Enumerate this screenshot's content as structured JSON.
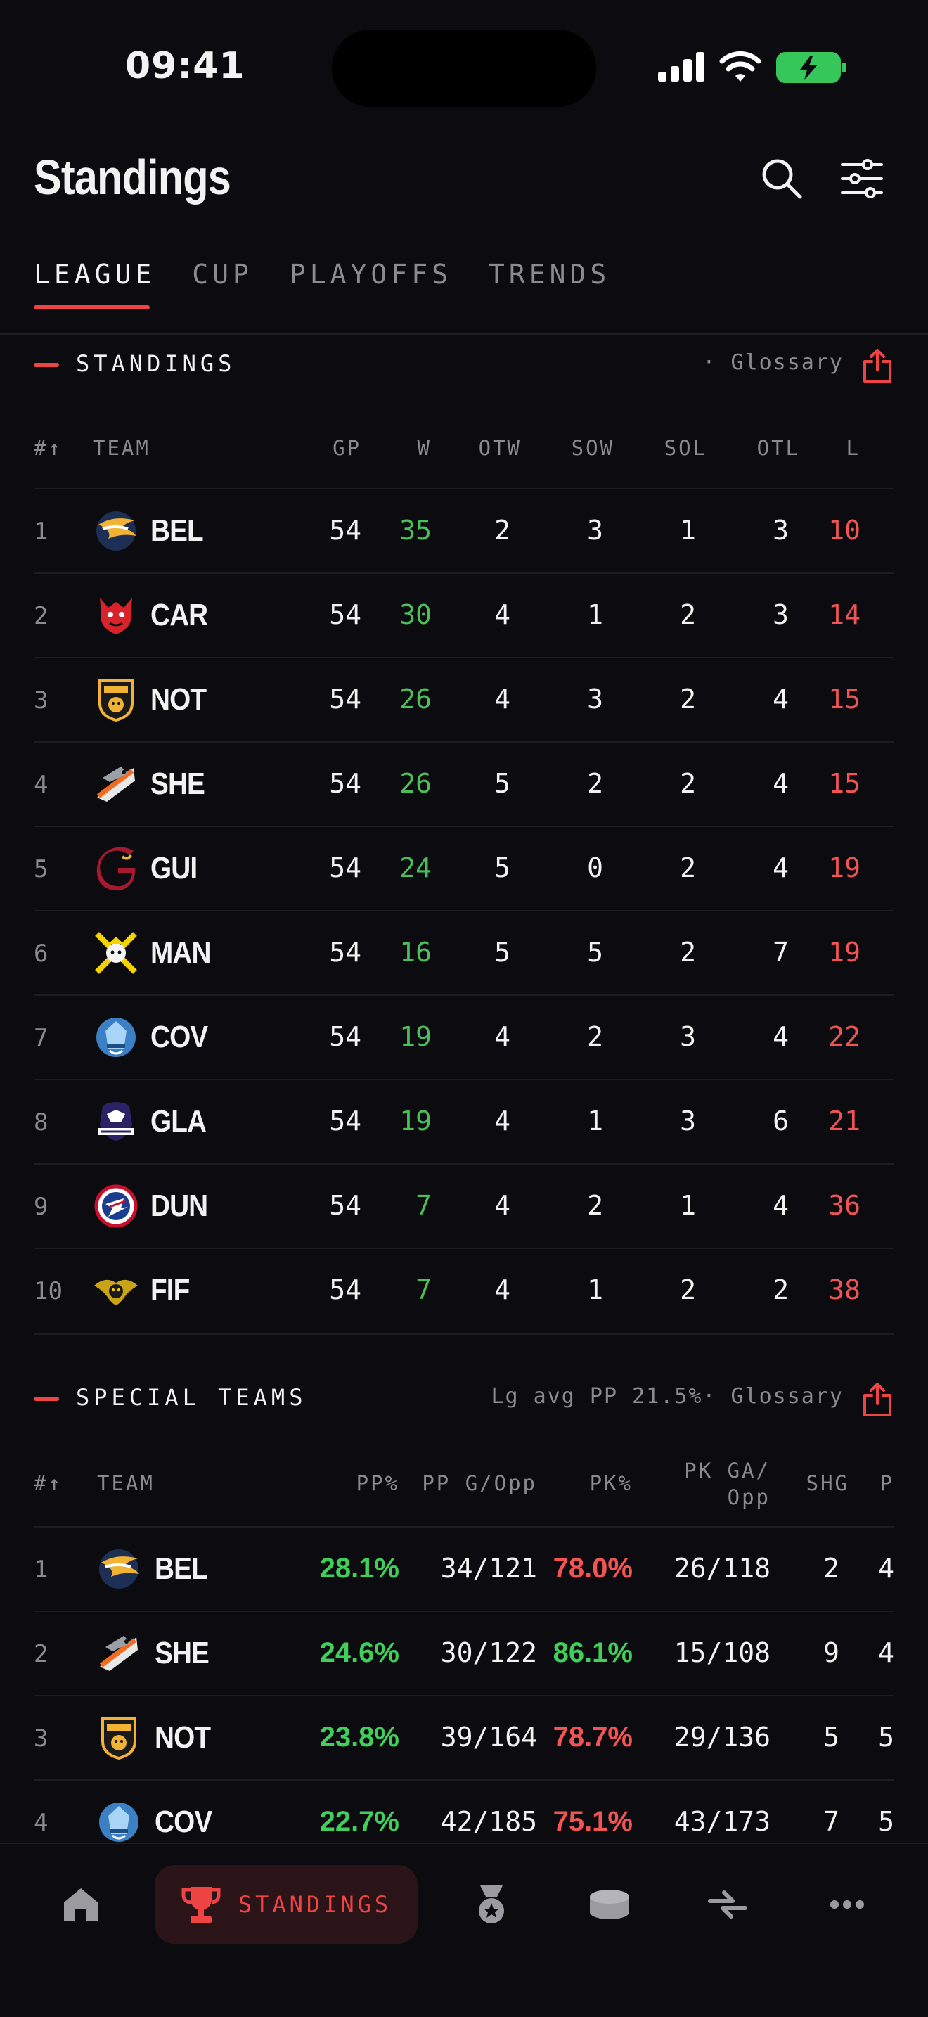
{
  "status_bar": {
    "time": "09:41"
  },
  "header": {
    "title": "Standings"
  },
  "tabs": [
    "LEAGUE",
    "CUP",
    "PLAYOFFS",
    "TRENDS"
  ],
  "standings": {
    "title": "STANDINGS",
    "right": "· Glossary",
    "columns": [
      "#↑",
      "TEAM",
      "GP",
      "W",
      "OTW",
      "SOW",
      "SOL",
      "OTL",
      "L"
    ],
    "rows": [
      {
        "rank": "1",
        "team": "BEL",
        "gp": "54",
        "w": "35",
        "otw": "2",
        "sow": "3",
        "sol": "1",
        "otl": "3",
        "l": "10"
      },
      {
        "rank": "2",
        "team": "CAR",
        "gp": "54",
        "w": "30",
        "otw": "4",
        "sow": "1",
        "sol": "2",
        "otl": "3",
        "l": "14"
      },
      {
        "rank": "3",
        "team": "NOT",
        "gp": "54",
        "w": "26",
        "otw": "4",
        "sow": "3",
        "sol": "2",
        "otl": "4",
        "l": "15"
      },
      {
        "rank": "4",
        "team": "SHE",
        "gp": "54",
        "w": "26",
        "otw": "5",
        "sow": "2",
        "sol": "2",
        "otl": "4",
        "l": "15"
      },
      {
        "rank": "5",
        "team": "GUI",
        "gp": "54",
        "w": "24",
        "otw": "5",
        "sow": "0",
        "sol": "2",
        "otl": "4",
        "l": "19"
      },
      {
        "rank": "6",
        "team": "MAN",
        "gp": "54",
        "w": "16",
        "otw": "5",
        "sow": "5",
        "sol": "2",
        "otl": "7",
        "l": "19"
      },
      {
        "rank": "7",
        "team": "COV",
        "gp": "54",
        "w": "19",
        "otw": "4",
        "sow": "2",
        "sol": "3",
        "otl": "4",
        "l": "22"
      },
      {
        "rank": "8",
        "team": "GLA",
        "gp": "54",
        "w": "19",
        "otw": "4",
        "sow": "1",
        "sol": "3",
        "otl": "6",
        "l": "21"
      },
      {
        "rank": "9",
        "team": "DUN",
        "gp": "54",
        "w": "7",
        "otw": "4",
        "sow": "2",
        "sol": "1",
        "otl": "4",
        "l": "36"
      },
      {
        "rank": "10",
        "team": "FIF",
        "gp": "54",
        "w": "7",
        "otw": "4",
        "sow": "1",
        "sol": "2",
        "otl": "2",
        "l": "38"
      }
    ]
  },
  "special_teams": {
    "title": "SPECIAL TEAMS",
    "right": "Lg avg PP 21.5%· Glossary",
    "columns": [
      "#↑",
      "TEAM",
      "PP%",
      "PP G/Opp",
      "PK%",
      "PK GA/",
      "Opp",
      "SHG",
      "P"
    ],
    "rows": [
      {
        "rank": "1",
        "team": "BEL",
        "pp": "28.1%",
        "ppg": "34/121",
        "pk": "78.0%",
        "pkga": "26/118",
        "shg": "2",
        "p": "4"
      },
      {
        "rank": "2",
        "team": "SHE",
        "pp": "24.6%",
        "ppg": "30/122",
        "pk": "86.1%",
        "pkga": "15/108",
        "shg": "9",
        "p": "4"
      },
      {
        "rank": "3",
        "team": "NOT",
        "pp": "23.8%",
        "ppg": "39/164",
        "pk": "78.7%",
        "pkga": "29/136",
        "shg": "5",
        "p": "5"
      },
      {
        "rank": "4",
        "team": "COV",
        "pp": "22.7%",
        "ppg": "42/185",
        "pk": "75.1%",
        "pkga": "43/173",
        "shg": "7",
        "p": "5"
      }
    ]
  },
  "bottom_nav": {
    "items": [
      {
        "icon": "home-icon"
      },
      {
        "icon": "trophy-icon",
        "label": "STANDINGS"
      },
      {
        "icon": "medal-icon"
      },
      {
        "icon": "puck-icon"
      },
      {
        "icon": "transfer-icon"
      },
      {
        "icon": "more-icon"
      }
    ]
  },
  "colors": {
    "accent": "#ef4444",
    "win": "#4cbf5a",
    "loss": "#f25454",
    "background": "#0c0c10"
  }
}
